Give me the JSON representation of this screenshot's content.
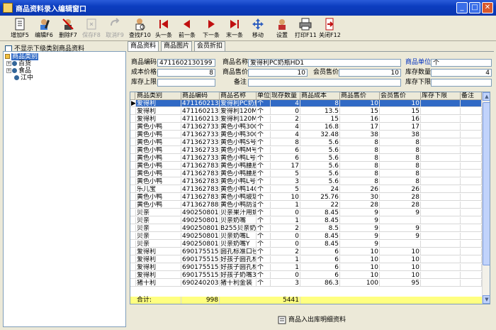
{
  "window": {
    "title": "商品资料录入编辑窗口",
    "minimize": "_",
    "maximize": "□",
    "close": "✕"
  },
  "toolbar": [
    {
      "label": "增加F5",
      "icon": "add-icon",
      "enabled": true
    },
    {
      "label": "编辑F6",
      "icon": "edit-icon",
      "enabled": true
    },
    {
      "label": "删除F7",
      "icon": "delete-icon",
      "enabled": true
    },
    {
      "label": "保存F8",
      "icon": "save-icon",
      "enabled": false
    },
    {
      "label": "取消F9",
      "icon": "undo-icon",
      "enabled": false
    },
    {
      "label": "查找F10",
      "icon": "find-icon",
      "enabled": true
    },
    {
      "label": "头一条",
      "icon": "first-record-icon",
      "enabled": true
    },
    {
      "label": "前一条",
      "icon": "previous-record-icon",
      "enabled": true
    },
    {
      "label": "下一条",
      "icon": "next-record-icon",
      "enabled": true
    },
    {
      "label": "末一条",
      "icon": "last-record-icon",
      "enabled": true
    },
    {
      "label": "移动",
      "icon": "move-icon",
      "enabled": true
    },
    {
      "label": "设置",
      "icon": "settings-icon",
      "enabled": true
    },
    {
      "label": "打印F11",
      "icon": "print-icon",
      "enabled": true
    },
    {
      "label": "关闭F12",
      "icon": "exit-icon",
      "enabled": true
    }
  ],
  "left": {
    "checkbox_label": "不显示下级类别商品资料",
    "checked": false,
    "tree": [
      {
        "label": "商品类别",
        "level": 0,
        "selected": true
      },
      {
        "label": "百货",
        "level": 1,
        "expander": "+"
      },
      {
        "label": "食品",
        "level": 1,
        "expander": "+"
      },
      {
        "label": "江中",
        "level": 1,
        "expander": ""
      }
    ]
  },
  "tabs": [
    "商品资料",
    "商品图片",
    "会员折扣"
  ],
  "form": {
    "code_label": "商品编码",
    "code_value": "4711602130199",
    "name_label": "商品名称",
    "name_value": "爱得利PC奶瓶HD1",
    "unit_label": "商品单位",
    "unit_value": "个",
    "cost_label": "成本价格",
    "cost_value": "8",
    "price_label": "商品售价",
    "price_value": "10",
    "member_price_label": "会员售价",
    "member_price_value": "10",
    "stock_qty_label": "库存数量",
    "stock_qty_value": "4",
    "stock_max_label": "库存上限",
    "stock_max_value": "",
    "remark_label": "备注",
    "remark_value": "",
    "stock_min_label": "库存下限",
    "stock_min_value": ""
  },
  "grid": {
    "columns": [
      "商品类别",
      "商品编码",
      "商品名称",
      "单位",
      "现存数量",
      "商品成本",
      "商品售价",
      "会员售价",
      "库存下限",
      "备注"
    ],
    "rows": [
      [
        "爱得利",
        "4711602130199",
        "爱得利PC奶瓶",
        "个",
        "4",
        "8",
        "10",
        "10",
        "",
        ""
      ],
      [
        "爱得利",
        "4711602131426",
        "爱得利120ML玻",
        "个",
        "0",
        "13.5",
        "15",
        "15",
        "",
        ""
      ],
      [
        "爱得利",
        "4711602134151",
        "爱得利120ML玻",
        "个",
        "2",
        "15",
        "16",
        "16",
        "",
        ""
      ],
      [
        "黄色小鸭",
        "4713627330220",
        "黄色小鸭300M",
        "个",
        "4",
        "16.8",
        "17",
        "17",
        "",
        ""
      ],
      [
        "黄色小鸭",
        "4713627330329",
        "黄色小鸭300M",
        "个",
        "4",
        "32.48",
        "38",
        "38",
        "",
        ""
      ],
      [
        "黄色小鸭",
        "4713627330503",
        "黄色小鸭S号奶",
        "个",
        "8",
        "5.6",
        "8",
        "8",
        "",
        ""
      ],
      [
        "黄色小鸭",
        "4713627330510",
        "黄色小鸭M号奶",
        "个",
        "6",
        "5.6",
        "8",
        "8",
        "",
        ""
      ],
      [
        "黄色小鸭",
        "4713627330527",
        "黄色小鸭L号奶",
        "个",
        "6",
        "5.6",
        "8",
        "8",
        "",
        ""
      ],
      [
        "黄色小鸭",
        "4713627830504",
        "黄色小鸭腰胶",
        "个",
        "17",
        "5.6",
        "8",
        "8",
        "",
        ""
      ],
      [
        "黄色小鸭",
        "4713627830511",
        "黄色小鸭腰胶",
        "个",
        "5",
        "5.6",
        "8",
        "8",
        "",
        ""
      ],
      [
        "黄色小鸭",
        "4713627830528",
        "黄色小鸭L号奶",
        "个",
        "3",
        "5.6",
        "8",
        "8",
        "",
        ""
      ],
      [
        "乐儿宝",
        "4713627833260",
        "黄色小鸭140M",
        "个",
        "5",
        "24",
        "26",
        "26",
        "",
        ""
      ],
      [
        "黄色小鸭",
        "4713627833277",
        "黄色小鸭玻璃",
        "个",
        "10",
        "25.76",
        "30",
        "28",
        "",
        ""
      ],
      [
        "黄色小鸭",
        "4713627881468",
        "黄色小鸭防溢",
        "个",
        "1",
        "22",
        "28",
        "28",
        "",
        ""
      ],
      [
        "贝亲",
        "4902508010597",
        "贝亲果汁用奶",
        "个",
        "0",
        "8.45",
        "9",
        "9",
        "",
        ""
      ],
      [
        "贝亲",
        "4902508012546",
        "贝亲奶嘴",
        "个",
        "1",
        "8.45",
        "9",
        "",
        "",
        ""
      ],
      [
        "贝亲",
        "4902508012553",
        "B255贝亲奶嘴",
        "个",
        "2",
        "8.5",
        "9",
        "9",
        "",
        ""
      ],
      [
        "贝亲",
        "4902508012560",
        "贝亲奶嘴L",
        "个",
        "0",
        "8.45",
        "9",
        "9",
        "",
        ""
      ],
      [
        "贝亲",
        "4902508012577",
        "贝亲奶嘴Y",
        "个",
        "0",
        "8.45",
        "9",
        "",
        "",
        ""
      ],
      [
        "爱得利",
        "6901755155851",
        "圆孔标准口径",
        "个",
        "2",
        "6",
        "10",
        "10",
        "",
        ""
      ],
      [
        "爱得利",
        "6901755155868",
        "好孩子圆孔标",
        "个",
        "1",
        "6",
        "10",
        "10",
        "",
        ""
      ],
      [
        "爱得利",
        "6901755155875",
        "好孩子圆孔标",
        "个",
        "1",
        "6",
        "10",
        "10",
        "",
        ""
      ],
      [
        "爱得利",
        "6901755155967",
        "好孩子奶嘴3号",
        "个",
        "0",
        "6",
        "10",
        "10",
        "",
        ""
      ],
      [
        "猪十利",
        "6902402030001",
        "猪十利金装",
        "个",
        "3",
        "86.3",
        "100",
        "95",
        "",
        ""
      ]
    ],
    "selected_row": 0,
    "footer_label": "合计:",
    "footer_code_total": "998",
    "footer_qty_total": "5441"
  },
  "bottom_button": "商品入出库明细资料"
}
